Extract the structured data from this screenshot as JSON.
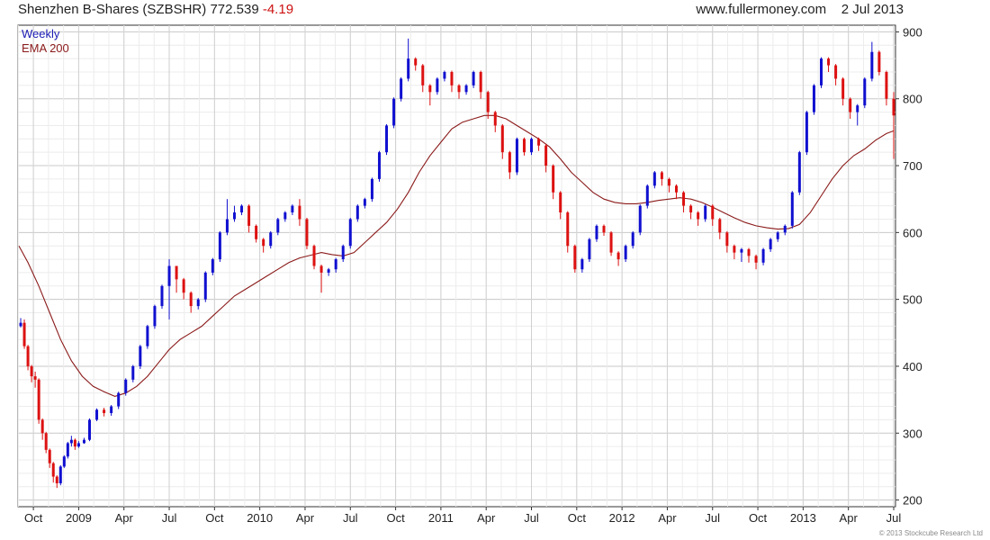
{
  "header": {
    "title": "Shenzhen B-Shares (SZBSHR)",
    "last": "772.539",
    "change": "-4.19",
    "source": "www.fullermoney.com",
    "date": "2 Jul 2013"
  },
  "legend": {
    "weekly": "Weekly",
    "ema": "EMA 200"
  },
  "copyright": "© 2013 Stockcube Research Ltd",
  "colors": {
    "up": "#1010d0",
    "down": "#dd1111",
    "ema": "#8b1a1a",
    "grid": "#d9d9d9",
    "axis": "#333333"
  },
  "chart_data": {
    "type": "line",
    "title": "Shenzhen B-Shares (SZBSHR)",
    "interval": "Weekly",
    "ylim": [
      190,
      910
    ],
    "y_ticks": [
      200,
      300,
      400,
      500,
      600,
      700,
      800,
      900
    ],
    "x_range": [
      2008.665,
      2013.51
    ],
    "x_ticks": [
      {
        "label": "Oct",
        "x": 2008.75
      },
      {
        "label": "2009",
        "x": 2009.0
      },
      {
        "label": "Apr",
        "x": 2009.25
      },
      {
        "label": "Jul",
        "x": 2009.5
      },
      {
        "label": "Oct",
        "x": 2009.75
      },
      {
        "label": "2010",
        "x": 2010.0
      },
      {
        "label": "Apr",
        "x": 2010.25
      },
      {
        "label": "Jul",
        "x": 2010.5
      },
      {
        "label": "Oct",
        "x": 2010.75
      },
      {
        "label": "2011",
        "x": 2011.0
      },
      {
        "label": "Apr",
        "x": 2011.25
      },
      {
        "label": "Jul",
        "x": 2011.5
      },
      {
        "label": "Oct",
        "x": 2011.75
      },
      {
        "label": "2012",
        "x": 2012.0
      },
      {
        "label": "Apr",
        "x": 2012.25
      },
      {
        "label": "Jul",
        "x": 2012.5
      },
      {
        "label": "Oct",
        "x": 2012.75
      },
      {
        "label": "2013",
        "x": 2013.0
      },
      {
        "label": "Apr",
        "x": 2013.25
      },
      {
        "label": "Jul",
        "x": 2013.5
      }
    ],
    "grid": true,
    "series": [
      {
        "name": "Weekly",
        "style": "candlestick",
        "x": [
          2008.68,
          2008.7,
          2008.72,
          2008.74,
          2008.76,
          2008.78,
          2008.8,
          2008.82,
          2008.84,
          2008.86,
          2008.88,
          2008.9,
          2008.92,
          2008.94,
          2008.96,
          2008.98,
          2009.0,
          2009.03,
          2009.06,
          2009.1,
          2009.14,
          2009.18,
          2009.22,
          2009.26,
          2009.3,
          2009.34,
          2009.38,
          2009.42,
          2009.46,
          2009.5,
          2009.54,
          2009.58,
          2009.62,
          2009.66,
          2009.7,
          2009.74,
          2009.78,
          2009.82,
          2009.86,
          2009.9,
          2009.94,
          2009.98,
          2010.02,
          2010.06,
          2010.1,
          2010.14,
          2010.18,
          2010.22,
          2010.26,
          2010.3,
          2010.34,
          2010.38,
          2010.42,
          2010.46,
          2010.5,
          2010.54,
          2010.58,
          2010.62,
          2010.66,
          2010.7,
          2010.74,
          2010.78,
          2010.82,
          2010.86,
          2010.9,
          2010.94,
          2010.98,
          2011.02,
          2011.06,
          2011.1,
          2011.14,
          2011.18,
          2011.22,
          2011.26,
          2011.3,
          2011.34,
          2011.38,
          2011.42,
          2011.46,
          2011.5,
          2011.54,
          2011.58,
          2011.62,
          2011.66,
          2011.7,
          2011.74,
          2011.78,
          2011.82,
          2011.86,
          2011.9,
          2011.94,
          2011.98,
          2012.02,
          2012.06,
          2012.1,
          2012.14,
          2012.18,
          2012.22,
          2012.26,
          2012.3,
          2012.34,
          2012.38,
          2012.42,
          2012.46,
          2012.5,
          2012.54,
          2012.58,
          2012.62,
          2012.66,
          2012.7,
          2012.74,
          2012.78,
          2012.82,
          2012.86,
          2012.9,
          2012.94,
          2012.98,
          2013.02,
          2013.06,
          2013.1,
          2013.14,
          2013.18,
          2013.22,
          2013.26,
          2013.3,
          2013.34,
          2013.38,
          2013.42,
          2013.46,
          2013.5
        ],
        "close": [
          465,
          430,
          400,
          385,
          380,
          320,
          300,
          275,
          255,
          235,
          225,
          250,
          265,
          285,
          290,
          280,
          285,
          290,
          320,
          335,
          330,
          340,
          360,
          380,
          400,
          430,
          460,
          490,
          520,
          550,
          530,
          510,
          490,
          500,
          540,
          560,
          600,
          620,
          630,
          640,
          610,
          590,
          580,
          600,
          620,
          630,
          640,
          620,
          580,
          550,
          540,
          545,
          560,
          580,
          620,
          640,
          650,
          680,
          720,
          760,
          800,
          830,
          860,
          850,
          820,
          810,
          830,
          840,
          820,
          810,
          820,
          840,
          810,
          780,
          760,
          720,
          690,
          740,
          720,
          740,
          730,
          700,
          660,
          630,
          580,
          545,
          560,
          590,
          610,
          600,
          570,
          560,
          580,
          600,
          640,
          670,
          690,
          680,
          670,
          660,
          640,
          630,
          620,
          640,
          620,
          600,
          580,
          570,
          575,
          565,
          555,
          575,
          590,
          600,
          610,
          660,
          720,
          780,
          820,
          860,
          850,
          830,
          800,
          780,
          790,
          830,
          870,
          840,
          800,
          775
        ],
        "high": [
          472,
          470,
          432,
          402,
          392,
          382,
          322,
          302,
          277,
          257,
          237,
          252,
          267,
          287,
          296,
          292,
          288,
          293,
          322,
          337,
          338,
          342,
          362,
          382,
          402,
          432,
          462,
          492,
          522,
          560,
          550,
          532,
          512,
          502,
          542,
          562,
          602,
          650,
          640,
          642,
          642,
          612,
          592,
          602,
          622,
          632,
          642,
          650,
          622,
          582,
          552,
          547,
          562,
          582,
          622,
          642,
          652,
          682,
          722,
          762,
          802,
          832,
          890,
          862,
          852,
          822,
          832,
          842,
          842,
          822,
          822,
          842,
          842,
          812,
          782,
          762,
          722,
          742,
          742,
          742,
          742,
          732,
          702,
          662,
          632,
          582,
          562,
          592,
          612,
          612,
          602,
          572,
          582,
          602,
          642,
          672,
          692,
          692,
          682,
          672,
          662,
          642,
          632,
          642,
          642,
          622,
          602,
          582,
          577,
          577,
          567,
          577,
          592,
          602,
          612,
          662,
          722,
          782,
          822,
          862,
          862,
          852,
          832,
          802,
          792,
          832,
          885,
          872,
          842,
          810
        ],
        "low": [
          458,
          426,
          394,
          376,
          368,
          314,
          290,
          270,
          248,
          226,
          218,
          222,
          248,
          262,
          280,
          275,
          278,
          284,
          288,
          318,
          325,
          326,
          336,
          356,
          376,
          396,
          426,
          456,
          486,
          470,
          510,
          500,
          480,
          485,
          496,
          536,
          556,
          596,
          616,
          626,
          600,
          585,
          570,
          576,
          596,
          616,
          626,
          610,
          575,
          545,
          510,
          535,
          540,
          556,
          576,
          616,
          636,
          646,
          676,
          716,
          756,
          796,
          826,
          842,
          810,
          790,
          806,
          826,
          810,
          800,
          806,
          816,
          800,
          770,
          750,
          710,
          680,
          686,
          715,
          716,
          722,
          690,
          650,
          620,
          570,
          540,
          540,
          556,
          586,
          595,
          565,
          550,
          556,
          576,
          596,
          636,
          666,
          670,
          660,
          650,
          630,
          620,
          610,
          616,
          610,
          590,
          570,
          560,
          556,
          555,
          545,
          551,
          571,
          586,
          596,
          606,
          656,
          716,
          776,
          816,
          840,
          820,
          790,
          770,
          760,
          786,
          826,
          835,
          790,
          710
        ],
        "open": [
          460,
          465,
          430,
          400,
          385,
          380,
          320,
          300,
          275,
          255,
          235,
          225,
          250,
          265,
          285,
          290,
          280,
          285,
          290,
          320,
          335,
          330,
          340,
          360,
          380,
          400,
          430,
          460,
          490,
          520,
          550,
          530,
          510,
          490,
          500,
          540,
          560,
          600,
          620,
          630,
          640,
          610,
          590,
          580,
          600,
          620,
          630,
          640,
          620,
          580,
          550,
          540,
          545,
          560,
          580,
          620,
          640,
          650,
          680,
          720,
          760,
          800,
          830,
          860,
          850,
          820,
          810,
          830,
          840,
          820,
          810,
          820,
          840,
          810,
          780,
          760,
          720,
          690,
          740,
          720,
          740,
          730,
          700,
          660,
          630,
          580,
          545,
          560,
          590,
          610,
          600,
          570,
          560,
          580,
          600,
          640,
          670,
          690,
          680,
          670,
          660,
          640,
          630,
          620,
          640,
          620,
          600,
          580,
          570,
          575,
          565,
          555,
          575,
          590,
          600,
          610,
          660,
          720,
          780,
          820,
          860,
          850,
          830,
          800,
          780,
          790,
          830,
          870,
          840,
          800
        ]
      },
      {
        "name": "EMA 200",
        "style": "line",
        "x": [
          2008.67,
          2008.72,
          2008.78,
          2008.84,
          2008.9,
          2008.96,
          2009.02,
          2009.08,
          2009.14,
          2009.2,
          2009.26,
          2009.32,
          2009.38,
          2009.44,
          2009.5,
          2009.56,
          2009.62,
          2009.68,
          2009.74,
          2009.8,
          2009.86,
          2009.92,
          2009.98,
          2010.04,
          2010.1,
          2010.16,
          2010.22,
          2010.28,
          2010.34,
          2010.4,
          2010.46,
          2010.52,
          2010.58,
          2010.64,
          2010.7,
          2010.76,
          2010.82,
          2010.88,
          2010.94,
          2011.0,
          2011.06,
          2011.12,
          2011.18,
          2011.24,
          2011.3,
          2011.36,
          2011.42,
          2011.48,
          2011.54,
          2011.6,
          2011.66,
          2011.72,
          2011.78,
          2011.84,
          2011.9,
          2011.96,
          2012.02,
          2012.08,
          2012.14,
          2012.2,
          2012.26,
          2012.32,
          2012.38,
          2012.44,
          2012.5,
          2012.56,
          2012.62,
          2012.68,
          2012.74,
          2012.8,
          2012.86,
          2012.92,
          2012.98,
          2013.04,
          2013.1,
          2013.16,
          2013.22,
          2013.28,
          2013.34,
          2013.4,
          2013.46,
          2013.5
        ],
        "y": [
          580,
          555,
          520,
          480,
          440,
          408,
          385,
          370,
          362,
          355,
          360,
          370,
          385,
          405,
          425,
          440,
          450,
          460,
          475,
          490,
          505,
          515,
          525,
          535,
          545,
          555,
          562,
          566,
          570,
          567,
          565,
          570,
          585,
          600,
          615,
          635,
          660,
          690,
          715,
          735,
          755,
          765,
          770,
          775,
          775,
          770,
          760,
          750,
          740,
          728,
          710,
          690,
          675,
          660,
          650,
          645,
          643,
          643,
          645,
          648,
          650,
          652,
          650,
          645,
          638,
          630,
          622,
          615,
          610,
          607,
          605,
          606,
          612,
          630,
          655,
          680,
          700,
          715,
          725,
          738,
          748,
          752
        ]
      }
    ]
  }
}
